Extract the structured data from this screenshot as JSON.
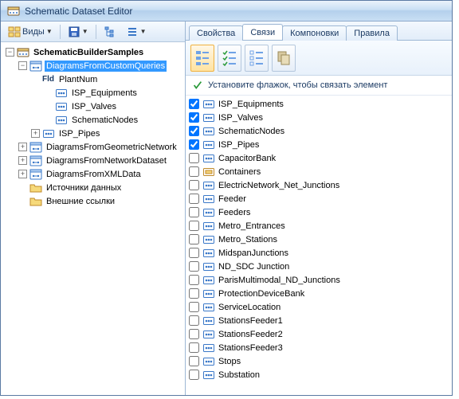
{
  "window": {
    "title": "Schematic Dataset Editor"
  },
  "toolbar": {
    "views_label": "Виды"
  },
  "tree": [
    {
      "indent": 0,
      "tw": "-",
      "iconType": "dataset",
      "label": "SchematicBuilderSamples",
      "bold": true
    },
    {
      "indent": 1,
      "tw": "-",
      "iconType": "diagram",
      "label": "DiagramsFromCustomQueries",
      "selected": true
    },
    {
      "indent": 2,
      "tw": "",
      "iconType": "fld",
      "label": "PlantNum"
    },
    {
      "indent": 3,
      "tw": "",
      "iconType": "dots",
      "label": "ISP_Equipments"
    },
    {
      "indent": 3,
      "tw": "",
      "iconType": "dots",
      "label": "ISP_Valves"
    },
    {
      "indent": 3,
      "tw": "",
      "iconType": "dots",
      "label": "SchematicNodes"
    },
    {
      "indent": 2,
      "tw": "+",
      "iconType": "dots",
      "label": "ISP_Pipes"
    },
    {
      "indent": 1,
      "tw": "+",
      "iconType": "diagram",
      "label": "DiagramsFromGeometricNetwork"
    },
    {
      "indent": 1,
      "tw": "+",
      "iconType": "diagram",
      "label": "DiagramsFromNetworkDataset"
    },
    {
      "indent": 1,
      "tw": "+",
      "iconType": "diagram",
      "label": "DiagramsFromXMLData"
    },
    {
      "indent": 1,
      "tw": "",
      "iconType": "folder",
      "label": "Источники данных"
    },
    {
      "indent": 1,
      "tw": "",
      "iconType": "folder",
      "label": "Внешние ссылки"
    }
  ],
  "tabs": {
    "items": [
      "Свойства",
      "Связи",
      "Компоновки",
      "Правила"
    ],
    "active": 1
  },
  "hint": "Установите флажок, чтобы связать элемент",
  "assoc_items": [
    {
      "checked": true,
      "icon": "dots",
      "label": "ISP_Equipments"
    },
    {
      "checked": true,
      "icon": "dots",
      "label": "ISP_Valves"
    },
    {
      "checked": true,
      "icon": "dots",
      "label": "SchematicNodes"
    },
    {
      "checked": true,
      "icon": "dots",
      "label": "ISP_Pipes"
    },
    {
      "checked": false,
      "icon": "dots",
      "label": "CapacitorBank"
    },
    {
      "checked": false,
      "icon": "container",
      "label": "Containers"
    },
    {
      "checked": false,
      "icon": "dots",
      "label": "ElectricNetwork_Net_Junctions"
    },
    {
      "checked": false,
      "icon": "dots",
      "label": "Feeder"
    },
    {
      "checked": false,
      "icon": "dots",
      "label": "Feeders"
    },
    {
      "checked": false,
      "icon": "dots",
      "label": "Metro_Entrances"
    },
    {
      "checked": false,
      "icon": "dots",
      "label": "Metro_Stations"
    },
    {
      "checked": false,
      "icon": "dots",
      "label": "MidspanJunctions"
    },
    {
      "checked": false,
      "icon": "dots",
      "label": "ND_SDC Junction"
    },
    {
      "checked": false,
      "icon": "dots",
      "label": "ParisMultimodal_ND_Junctions"
    },
    {
      "checked": false,
      "icon": "dots",
      "label": "ProtectionDeviceBank"
    },
    {
      "checked": false,
      "icon": "dots",
      "label": "ServiceLocation"
    },
    {
      "checked": false,
      "icon": "dots",
      "label": "StationsFeeder1"
    },
    {
      "checked": false,
      "icon": "dots",
      "label": "StationsFeeder2"
    },
    {
      "checked": false,
      "icon": "dots",
      "label": "StationsFeeder3"
    },
    {
      "checked": false,
      "icon": "dots",
      "label": "Stops"
    },
    {
      "checked": false,
      "icon": "dots",
      "label": "Substation"
    }
  ],
  "icons": {
    "checklist_sel": "list-select",
    "checklist_check": "list-check",
    "checklist_uncheck": "list-uncheck",
    "duplicate": "duplicate"
  }
}
